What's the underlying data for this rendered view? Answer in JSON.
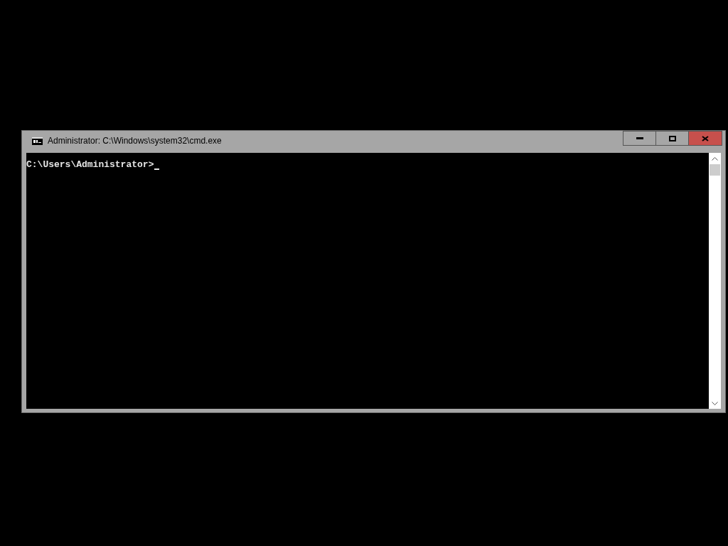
{
  "window": {
    "title": "Administrator: C:\\Windows\\system32\\cmd.exe"
  },
  "console": {
    "lines": [
      "C:\\Users\\Administrator>"
    ],
    "cursor": true
  }
}
